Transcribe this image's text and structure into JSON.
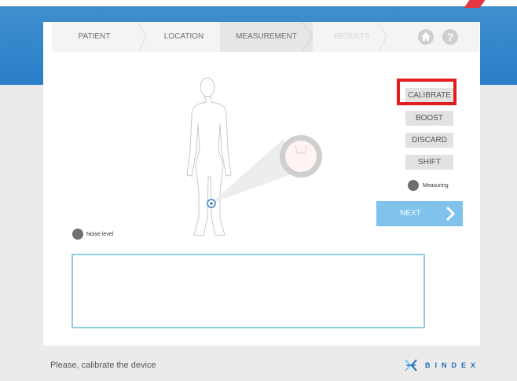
{
  "wizard": {
    "steps": [
      {
        "label": "PATIENT",
        "state": "done"
      },
      {
        "label": "LOCATION",
        "state": "done"
      },
      {
        "label": "MEASUREMENT",
        "state": "active"
      },
      {
        "label": "RESULTS",
        "state": "disabled"
      }
    ],
    "icons": [
      "home-icon",
      "help-icon"
    ]
  },
  "help_glyph": "?",
  "actions": {
    "calibrate": "CALIBRATE",
    "boost": "BOOST",
    "discard": "DISCARD",
    "shift": "SHIFT"
  },
  "measuring_label": "Measuring",
  "noise_label": "Noise level",
  "next_label": "NEXT",
  "status_text": "Please, calibrate the device",
  "brand": "BINDEX",
  "colors": {
    "accent_blue": "#2b7fc8",
    "next_button": "#7fc3ec",
    "highlight_red": "#e11d1d",
    "indicator_gray": "#6f6f6f"
  }
}
